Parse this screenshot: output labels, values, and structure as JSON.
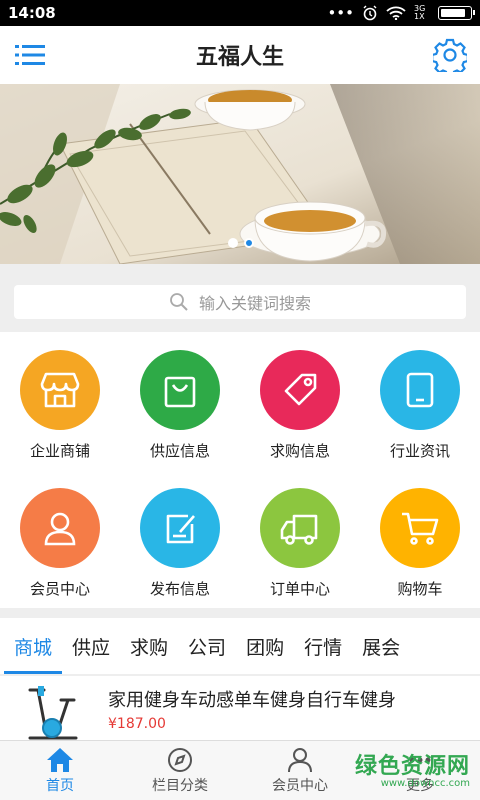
{
  "status_bar": {
    "time": "14:08",
    "network": "3G 1X"
  },
  "header": {
    "title": "五福人生",
    "menu_icon": "menu-icon",
    "settings_icon": "gear-icon"
  },
  "banner": {
    "slide_count": 2,
    "active_slide": 0
  },
  "search": {
    "placeholder": "输入关键词搜索"
  },
  "categories": [
    {
      "label": "企业商铺",
      "icon": "store-icon",
      "color": "#f5a623"
    },
    {
      "label": "供应信息",
      "icon": "shopping-bag-icon",
      "color": "#2eaa47"
    },
    {
      "label": "求购信息",
      "icon": "price-tag-icon",
      "color": "#e8295a"
    },
    {
      "label": "行业资讯",
      "icon": "tablet-icon",
      "color": "#29b6e6"
    },
    {
      "label": "会员中心",
      "icon": "user-icon",
      "color": "#f57c47"
    },
    {
      "label": "发布信息",
      "icon": "edit-icon",
      "color": "#29b6e6"
    },
    {
      "label": "订单中心",
      "icon": "truck-icon",
      "color": "#8cc63f"
    },
    {
      "label": "购物车",
      "icon": "cart-icon",
      "color": "#ffb300"
    }
  ],
  "tabs": [
    "商城",
    "供应",
    "求购",
    "公司",
    "团购",
    "行情",
    "展会"
  ],
  "product": {
    "name": "家用健身车动感单车健身自行车健身",
    "price": "¥187.00"
  },
  "bottom_nav": [
    {
      "label": "首页",
      "icon": "home-icon"
    },
    {
      "label": "栏目分类",
      "icon": "compass-icon"
    },
    {
      "label": "会员中心",
      "icon": "user-icon"
    },
    {
      "label": "更多",
      "icon": "more-icon"
    }
  ],
  "watermark": {
    "title": "绿色资源网",
    "url": "www.downcc.com"
  },
  "colors": {
    "accent": "#1e88e5",
    "price": "#e53935"
  }
}
